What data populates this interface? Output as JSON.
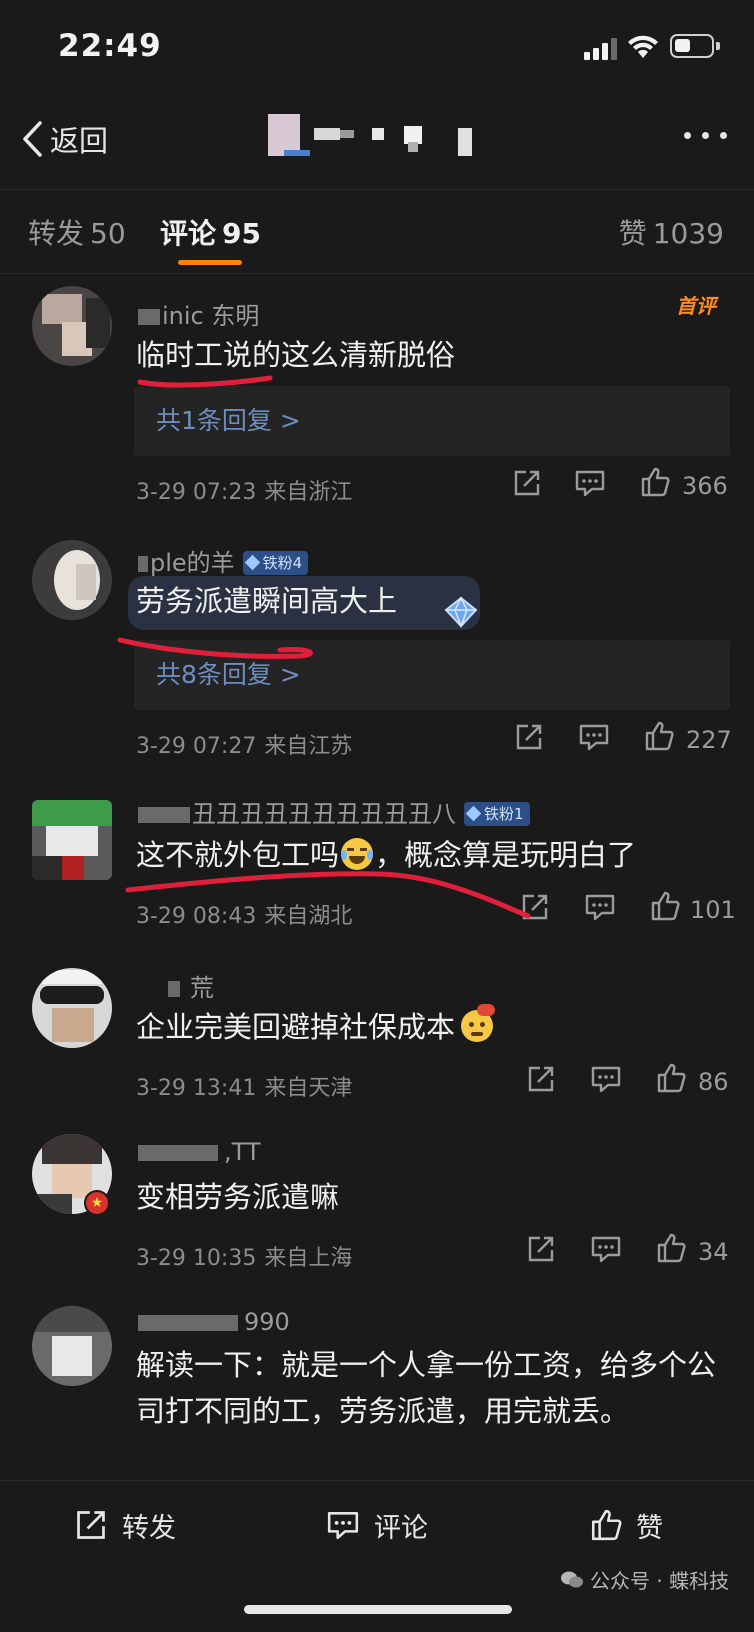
{
  "status_bar": {
    "time": "22:49"
  },
  "nav": {
    "back_label": "返回"
  },
  "tabs": {
    "forward_label": "转发",
    "forward_count": "50",
    "comment_label": "评论",
    "comment_count": "95",
    "like_label": "赞",
    "like_count": "1039"
  },
  "comments": [
    {
      "username": "inic 东明",
      "text": "临时工说的这么清新脱俗",
      "reply": "共1条回复 >",
      "date": "3-29 07:23",
      "location": "来自浙江",
      "likes": "366",
      "first_label": "首评"
    },
    {
      "username": "ple的羊",
      "badge": "铁粉4",
      "text": "劳务派遣瞬间高大上",
      "reply": "共8条回复 >",
      "date": "3-29 07:27",
      "location": "来自江苏",
      "likes": "227"
    },
    {
      "username": "丑丑丑丑丑丑丑丑丑丑八",
      "badge": "铁粉1",
      "text_before_emoji": "这不就外包工吗",
      "text_after_emoji": "，概念算是玩明白了",
      "date": "3-29 08:43",
      "location": "来自湖北",
      "likes": "101"
    },
    {
      "username": "荒",
      "text": "企业完美回避掉社保成本",
      "date": "3-29 13:41",
      "location": "来自天津",
      "likes": "86"
    },
    {
      "username": ",TT",
      "text": "变相劳务派遣嘛",
      "date": "3-29 10:35",
      "location": "来自上海",
      "likes": "34"
    },
    {
      "username": "990",
      "text": "解读一下：就是一个人拿一份工资，给多个公司打不同的工，劳务派遣，用完就丢。"
    }
  ],
  "bottom_bar": {
    "forward_label": "转发",
    "comment_label": "评论",
    "like_label": "赞"
  },
  "watermark": "公众号 · 蝶科技",
  "colors": {
    "background": "#1a1a1a",
    "accent": "#ff8200",
    "link": "#6c8dbd",
    "badge": "#2c4f86",
    "annotation": "#e0203a"
  }
}
